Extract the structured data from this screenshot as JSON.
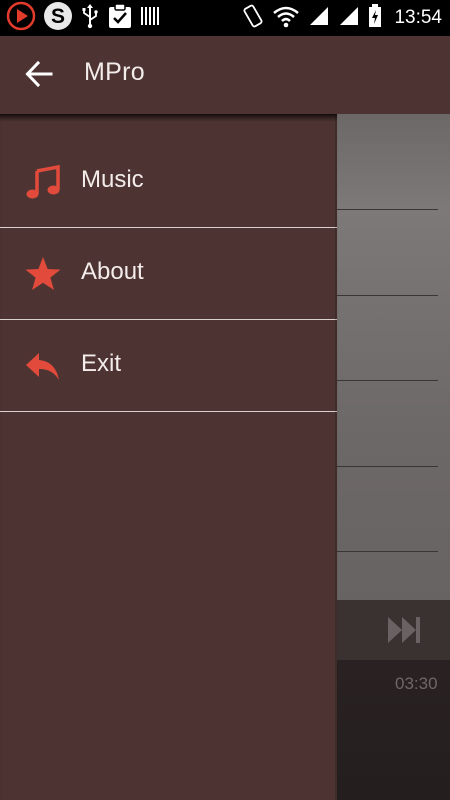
{
  "status_bar": {
    "time": "13:54",
    "icons": [
      "play-icon",
      "skype-icon",
      "usb-icon",
      "clipboard-check-icon",
      "barcode-icon",
      "vibrate-icon",
      "wifi-icon",
      "signal-icon",
      "signal-icon-2",
      "battery-charging-icon"
    ]
  },
  "app_bar": {
    "title": "MPro",
    "back_icon": "arrow-left-icon"
  },
  "drawer": {
    "items": [
      {
        "label": "Music",
        "icon": "music-note-icon"
      },
      {
        "label": "About",
        "icon": "star-icon"
      },
      {
        "label": "Exit",
        "icon": "reply-arrow-icon"
      }
    ]
  },
  "background_player": {
    "time": "03:30",
    "controls": [
      "fast-forward-icon"
    ]
  },
  "colors": {
    "drawer_bg": "#4d3432",
    "accent": "#e24a3b",
    "text": "#f3ecea"
  }
}
